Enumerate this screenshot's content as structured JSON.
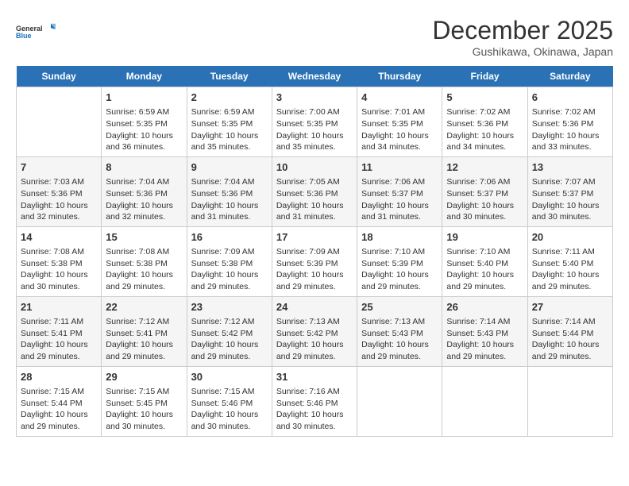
{
  "header": {
    "logo_line1": "General",
    "logo_line2": "Blue",
    "month": "December 2025",
    "location": "Gushikawa, Okinawa, Japan"
  },
  "weekdays": [
    "Sunday",
    "Monday",
    "Tuesday",
    "Wednesday",
    "Thursday",
    "Friday",
    "Saturday"
  ],
  "weeks": [
    [
      {
        "day": "",
        "info": ""
      },
      {
        "day": "1",
        "info": "Sunrise: 6:59 AM\nSunset: 5:35 PM\nDaylight: 10 hours\nand 36 minutes."
      },
      {
        "day": "2",
        "info": "Sunrise: 6:59 AM\nSunset: 5:35 PM\nDaylight: 10 hours\nand 35 minutes."
      },
      {
        "day": "3",
        "info": "Sunrise: 7:00 AM\nSunset: 5:35 PM\nDaylight: 10 hours\nand 35 minutes."
      },
      {
        "day": "4",
        "info": "Sunrise: 7:01 AM\nSunset: 5:35 PM\nDaylight: 10 hours\nand 34 minutes."
      },
      {
        "day": "5",
        "info": "Sunrise: 7:02 AM\nSunset: 5:36 PM\nDaylight: 10 hours\nand 34 minutes."
      },
      {
        "day": "6",
        "info": "Sunrise: 7:02 AM\nSunset: 5:36 PM\nDaylight: 10 hours\nand 33 minutes."
      }
    ],
    [
      {
        "day": "7",
        "info": "Sunrise: 7:03 AM\nSunset: 5:36 PM\nDaylight: 10 hours\nand 32 minutes."
      },
      {
        "day": "8",
        "info": "Sunrise: 7:04 AM\nSunset: 5:36 PM\nDaylight: 10 hours\nand 32 minutes."
      },
      {
        "day": "9",
        "info": "Sunrise: 7:04 AM\nSunset: 5:36 PM\nDaylight: 10 hours\nand 31 minutes."
      },
      {
        "day": "10",
        "info": "Sunrise: 7:05 AM\nSunset: 5:36 PM\nDaylight: 10 hours\nand 31 minutes."
      },
      {
        "day": "11",
        "info": "Sunrise: 7:06 AM\nSunset: 5:37 PM\nDaylight: 10 hours\nand 31 minutes."
      },
      {
        "day": "12",
        "info": "Sunrise: 7:06 AM\nSunset: 5:37 PM\nDaylight: 10 hours\nand 30 minutes."
      },
      {
        "day": "13",
        "info": "Sunrise: 7:07 AM\nSunset: 5:37 PM\nDaylight: 10 hours\nand 30 minutes."
      }
    ],
    [
      {
        "day": "14",
        "info": "Sunrise: 7:08 AM\nSunset: 5:38 PM\nDaylight: 10 hours\nand 30 minutes."
      },
      {
        "day": "15",
        "info": "Sunrise: 7:08 AM\nSunset: 5:38 PM\nDaylight: 10 hours\nand 29 minutes."
      },
      {
        "day": "16",
        "info": "Sunrise: 7:09 AM\nSunset: 5:38 PM\nDaylight: 10 hours\nand 29 minutes."
      },
      {
        "day": "17",
        "info": "Sunrise: 7:09 AM\nSunset: 5:39 PM\nDaylight: 10 hours\nand 29 minutes."
      },
      {
        "day": "18",
        "info": "Sunrise: 7:10 AM\nSunset: 5:39 PM\nDaylight: 10 hours\nand 29 minutes."
      },
      {
        "day": "19",
        "info": "Sunrise: 7:10 AM\nSunset: 5:40 PM\nDaylight: 10 hours\nand 29 minutes."
      },
      {
        "day": "20",
        "info": "Sunrise: 7:11 AM\nSunset: 5:40 PM\nDaylight: 10 hours\nand 29 minutes."
      }
    ],
    [
      {
        "day": "21",
        "info": "Sunrise: 7:11 AM\nSunset: 5:41 PM\nDaylight: 10 hours\nand 29 minutes."
      },
      {
        "day": "22",
        "info": "Sunrise: 7:12 AM\nSunset: 5:41 PM\nDaylight: 10 hours\nand 29 minutes."
      },
      {
        "day": "23",
        "info": "Sunrise: 7:12 AM\nSunset: 5:42 PM\nDaylight: 10 hours\nand 29 minutes."
      },
      {
        "day": "24",
        "info": "Sunrise: 7:13 AM\nSunset: 5:42 PM\nDaylight: 10 hours\nand 29 minutes."
      },
      {
        "day": "25",
        "info": "Sunrise: 7:13 AM\nSunset: 5:43 PM\nDaylight: 10 hours\nand 29 minutes."
      },
      {
        "day": "26",
        "info": "Sunrise: 7:14 AM\nSunset: 5:43 PM\nDaylight: 10 hours\nand 29 minutes."
      },
      {
        "day": "27",
        "info": "Sunrise: 7:14 AM\nSunset: 5:44 PM\nDaylight: 10 hours\nand 29 minutes."
      }
    ],
    [
      {
        "day": "28",
        "info": "Sunrise: 7:15 AM\nSunset: 5:44 PM\nDaylight: 10 hours\nand 29 minutes."
      },
      {
        "day": "29",
        "info": "Sunrise: 7:15 AM\nSunset: 5:45 PM\nDaylight: 10 hours\nand 30 minutes."
      },
      {
        "day": "30",
        "info": "Sunrise: 7:15 AM\nSunset: 5:46 PM\nDaylight: 10 hours\nand 30 minutes."
      },
      {
        "day": "31",
        "info": "Sunrise: 7:16 AM\nSunset: 5:46 PM\nDaylight: 10 hours\nand 30 minutes."
      },
      {
        "day": "",
        "info": ""
      },
      {
        "day": "",
        "info": ""
      },
      {
        "day": "",
        "info": ""
      }
    ]
  ]
}
